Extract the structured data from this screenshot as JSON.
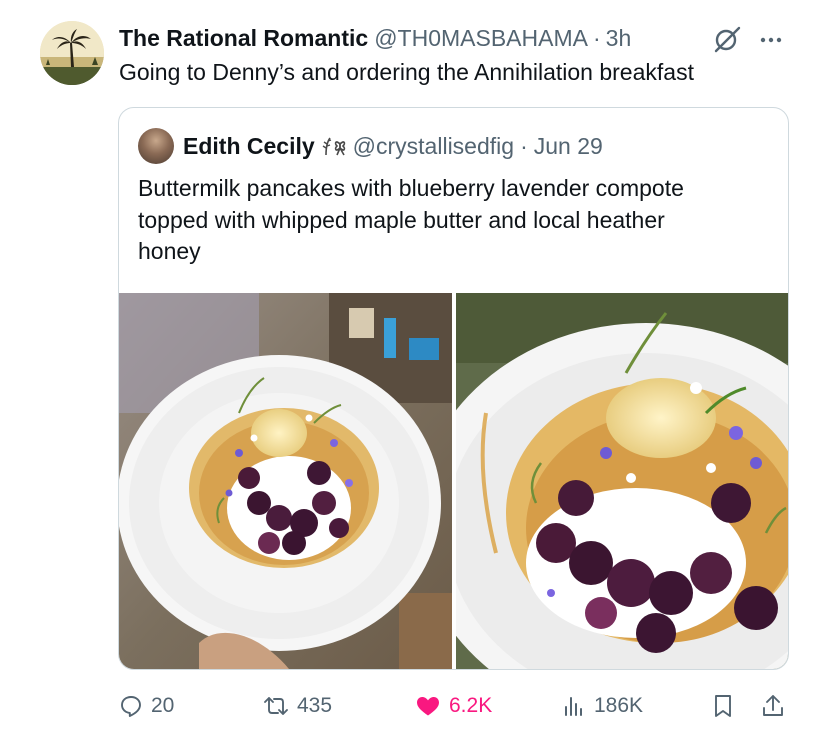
{
  "tweet": {
    "author_name": "The Rational Romantic",
    "handle": "@TH0MASBAHAMA",
    "separator": "·",
    "time": "3h",
    "text": "Going to Denny’s and ordering the Annihilation breakfast"
  },
  "quoted": {
    "author_name": "Edith Cecily",
    "handle": "@crystallisedfig",
    "separator": "·",
    "date": "Jun 29",
    "text_lines": [
      "Buttermilk pancakes with blueberry lavender compote",
      "topped with whipped maple butter and local heather",
      "honey"
    ],
    "name_emoji_icon": "fern-and-bow-emoji"
  },
  "actions": {
    "replies": "20",
    "reposts": "435",
    "likes": "6.2K",
    "views": "186K"
  },
  "icons": [
    "grok-icon",
    "more-icon",
    "reply-icon",
    "retweet-icon",
    "heart-icon",
    "views-icon",
    "bookmark-icon",
    "share-icon"
  ],
  "colors": {
    "text": "#0f1419",
    "secondary": "#536471",
    "like": "#f91880",
    "border": "#cfd9de"
  }
}
